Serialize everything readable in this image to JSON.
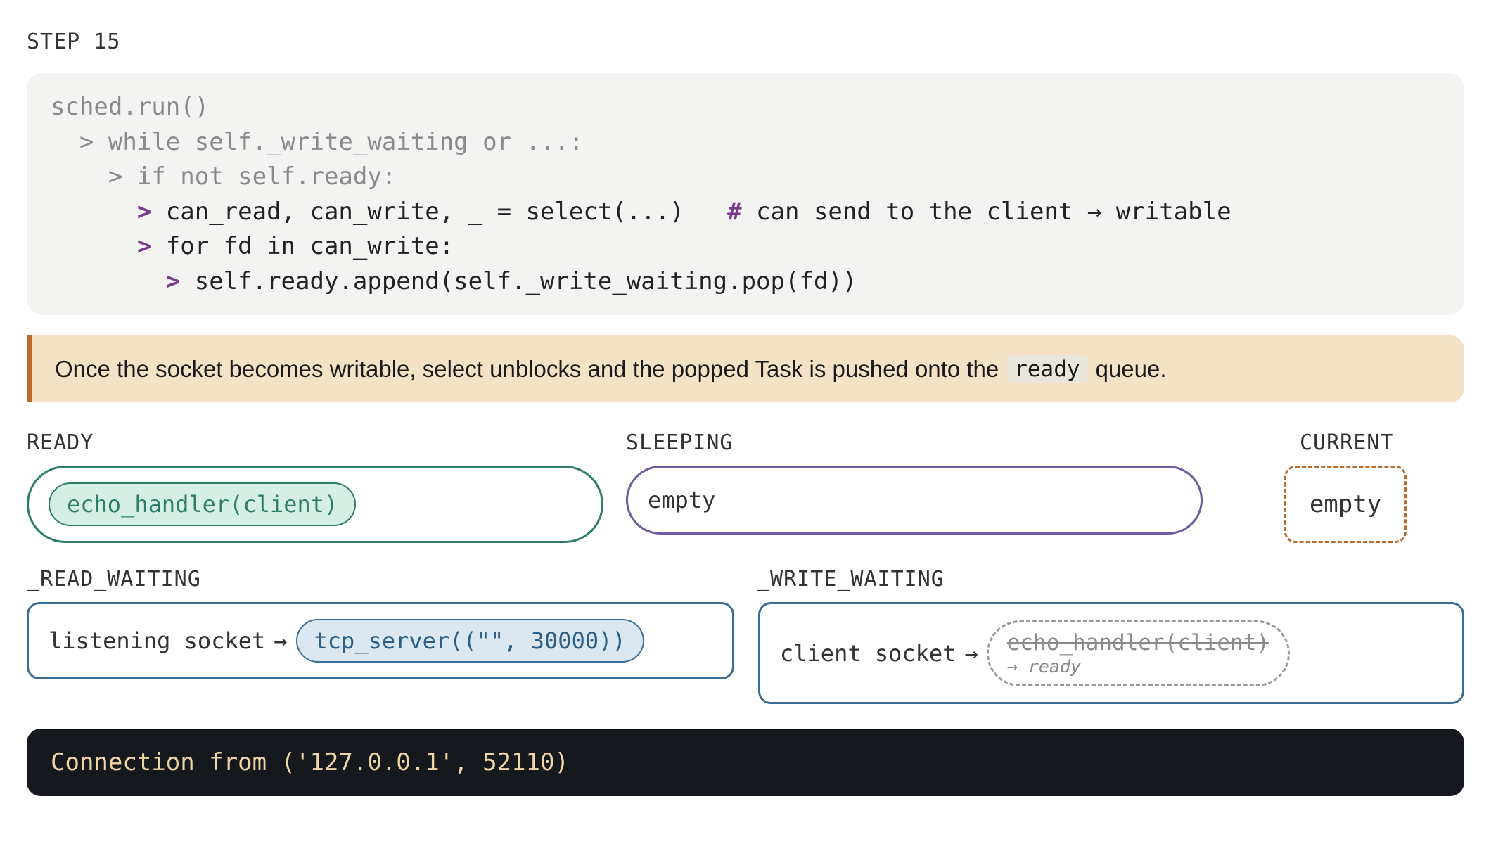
{
  "step": {
    "label": "STEP 15"
  },
  "code": {
    "lines": [
      {
        "caret": "",
        "text": "sched.run()"
      },
      {
        "caret": "> ",
        "text": "while self._write_waiting or ...:"
      },
      {
        "caret": "> ",
        "text": "if not self.ready:"
      },
      {
        "caret": "> ",
        "text": "can_read, can_write, _ = select(...)   ",
        "hash": "#",
        "comment": " can send to the client → writable"
      },
      {
        "caret": "> ",
        "text": "for fd in can_write:"
      },
      {
        "caret": "> ",
        "text": "self.ready.append(self._write_waiting.pop(fd))"
      }
    ]
  },
  "note": {
    "before": "Once the socket becomes writable, select unblocks and the popped Task is pushed onto the",
    "code": "ready",
    "after": "queue."
  },
  "ready": {
    "label": "READY",
    "items": [
      "echo_handler(client)"
    ]
  },
  "sleeping": {
    "label": "SLEEPING",
    "empty_text": "empty"
  },
  "current": {
    "label": "CURRENT",
    "value": "empty"
  },
  "read_waiting": {
    "label": "_READ_WAITING",
    "key": "listening socket",
    "arrow": "→",
    "task": "tcp_server((\"\", 30000))"
  },
  "write_waiting": {
    "label": "_WRITE_WAITING",
    "key": "client socket",
    "arrow": "→",
    "task": "echo_handler(client)",
    "moved_to": "→ ready"
  },
  "terminal": {
    "output": "Connection from ('127.0.0.1', 52110)"
  },
  "colors": {
    "ready": "#2e7d6b",
    "sleeping": "#6e5a9e",
    "current": "#b76b2c",
    "waiting": "#3b6e96",
    "accent": "#7a3b8f"
  }
}
